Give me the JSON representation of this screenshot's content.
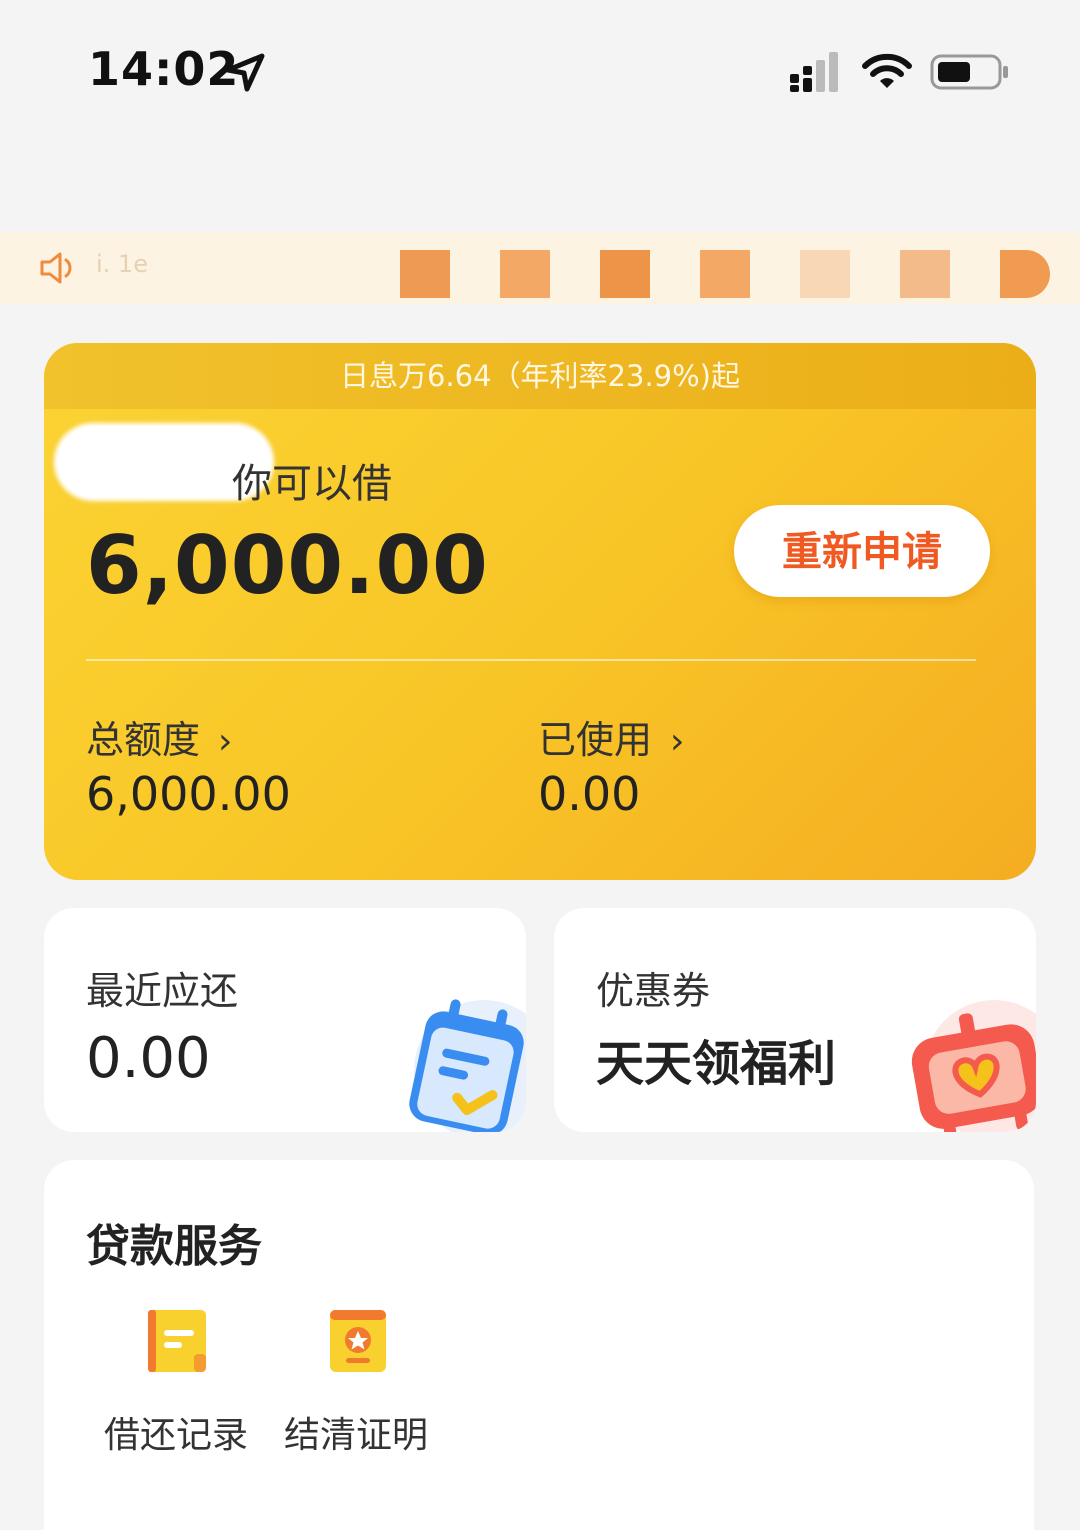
{
  "status_bar": {
    "time": "14:02",
    "icons": [
      "location-arrow-icon",
      "cellular-signal-icon",
      "wifi-icon",
      "battery-icon"
    ]
  },
  "notice": {
    "icon": "speaker-icon",
    "text": "i. 1e"
  },
  "credit": {
    "rate_banner": "日息万6.64（年利率23.9%)起",
    "can_borrow_label": "你可以借",
    "available_amount": "6,000.00",
    "reapply_label": "重新申请",
    "total_label": "总额度",
    "total_value": "6,000.00",
    "used_label": "已使用",
    "used_value": "0.00",
    "colors": {
      "card_start": "#fbd433",
      "card_end": "#f5ad22",
      "button_text": "#f05a22"
    }
  },
  "repay_card": {
    "title": "最近应还",
    "value": "0.00",
    "icon": "calendar-check-icon"
  },
  "coupon_card": {
    "title": "优惠券",
    "slogan": "天天领福利",
    "icon": "heart-gift-icon"
  },
  "services": {
    "title": "贷款服务",
    "items": [
      {
        "label": "借还记录",
        "icon": "record-book-icon"
      },
      {
        "label": "结清证明",
        "icon": "certificate-star-icon"
      }
    ]
  }
}
